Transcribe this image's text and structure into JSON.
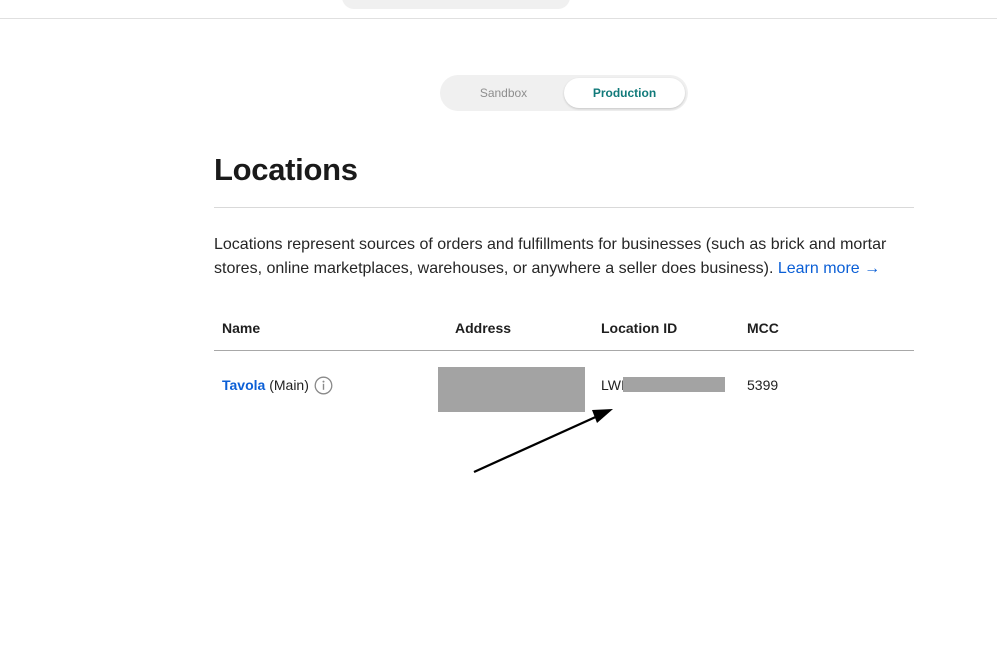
{
  "environment": {
    "tabs": [
      {
        "label": "Sandbox",
        "active": false
      },
      {
        "label": "Production",
        "active": true
      }
    ]
  },
  "page": {
    "title": "Locations",
    "description": "Locations represent sources of orders and fulfillments for businesses (such as brick and mortar stores, online marketplaces, warehouses, or anywhere a seller does business).",
    "learn_more": "Learn more →"
  },
  "table": {
    "columns": [
      "Name",
      "Address",
      "Location ID",
      "MCC"
    ],
    "rows": [
      {
        "name": "Tavola",
        "name_suffix": "(Main)",
        "address": "",
        "location_id_prefix": "LWI",
        "mcc": "5399"
      }
    ]
  },
  "icons": {
    "info": "info-circle-icon",
    "search": "search-icon"
  },
  "colors": {
    "link": "#0b5fd6",
    "active_tab": "#117a7a",
    "redaction": "#a3a3a3"
  }
}
